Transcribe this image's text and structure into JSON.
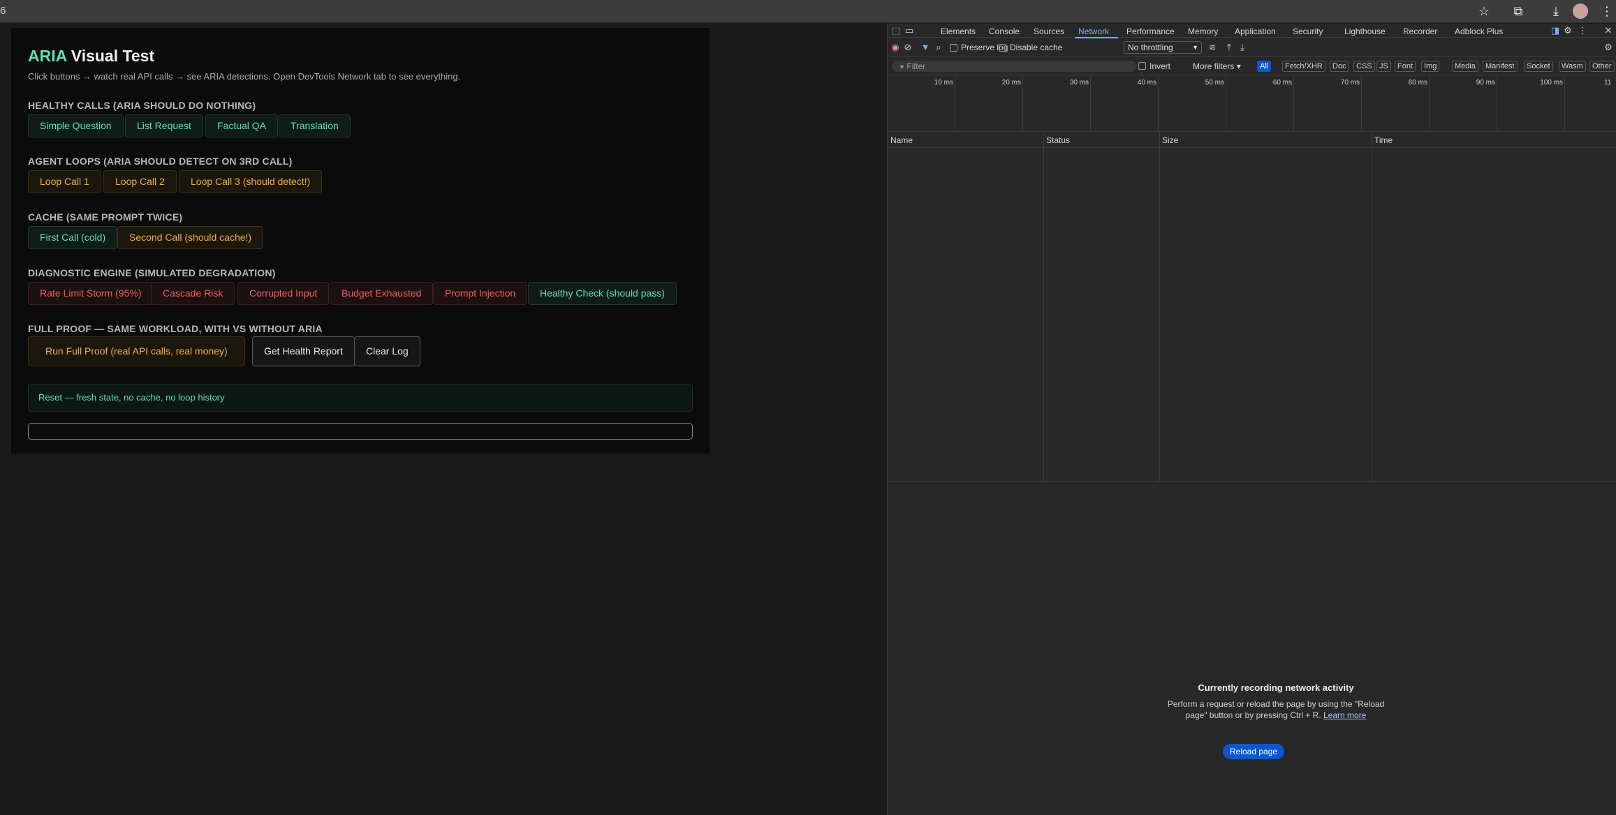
{
  "browser": {
    "left_fragment": "6",
    "icons": [
      "star-icon",
      "extensions-icon",
      "download-icon",
      "profile-icon",
      "more-icon"
    ]
  },
  "page": {
    "title_accent": "ARIA",
    "title_rest": " Visual Test",
    "subtitle": "Click buttons → watch real API calls → see ARIA detections. Open DevTools Network tab to see everything.",
    "sections": {
      "healthy": {
        "heading": "HEALTHY CALLS (ARIA SHOULD DO NOTHING)",
        "buttons": [
          "Simple Question",
          "List Request",
          "Factual QA",
          "Translation"
        ]
      },
      "loops": {
        "heading": "AGENT LOOPS (ARIA SHOULD DETECT ON 3RD CALL)",
        "buttons": [
          "Loop Call 1",
          "Loop Call 2",
          "Loop Call 3 (should detect!)"
        ]
      },
      "cache": {
        "heading": "CACHE (SAME PROMPT TWICE)",
        "buttons": [
          "First Call (cold)",
          "Second Call (should cache!)"
        ]
      },
      "diagnostic": {
        "heading": "DIAGNOSTIC ENGINE (SIMULATED DEGRADATION)",
        "buttons": [
          "Rate Limit Storm (95%)",
          "Cascade Risk",
          "Corrupted Input",
          "Budget Exhausted",
          "Prompt Injection",
          "Healthy Check (should pass)"
        ]
      },
      "proof": {
        "heading": "FULL PROOF — SAME WORKLOAD, WITH VS WITHOUT ARIA",
        "buttons": [
          "Run Full Proof (real API calls, real money)",
          "Get Health Report",
          "Clear Log"
        ]
      }
    },
    "status": "Reset — fresh state, no cache, no loop history",
    "colors": {
      "accent": "#5fe0b3",
      "warn": "#f2b03f",
      "danger": "#f0605d"
    }
  },
  "devtools": {
    "tabs": [
      "Elements",
      "Console",
      "Sources",
      "Network",
      "Performance",
      "Memory",
      "Application",
      "Security",
      "Lighthouse",
      "Recorder",
      "Adblock Plus"
    ],
    "active_tab": "Network",
    "toolbar": {
      "preserve_log": "Preserve log",
      "disable_cache": "Disable cache",
      "throttling": "No throttling"
    },
    "filter": {
      "placeholder": "Filter",
      "invert": "Invert",
      "more_filters": "More filters",
      "types": [
        "All",
        "Fetch/XHR",
        "Doc",
        "CSS",
        "JS",
        "Font",
        "Img",
        "Media",
        "Manifest",
        "Socket",
        "Wasm",
        "Other"
      ],
      "active_type": "All"
    },
    "timeline_ticks": [
      "10 ms",
      "20 ms",
      "30 ms",
      "40 ms",
      "50 ms",
      "60 ms",
      "70 ms",
      "80 ms",
      "90 ms",
      "100 ms",
      "11"
    ],
    "columns": [
      "Name",
      "Status",
      "Size",
      "Time"
    ],
    "empty": {
      "heading": "Currently recording network activity",
      "text": "Perform a request or reload the page by using the \"Reload page\" button or by pressing Ctrl + R.",
      "link": "Learn more",
      "button": "Reload page"
    }
  }
}
